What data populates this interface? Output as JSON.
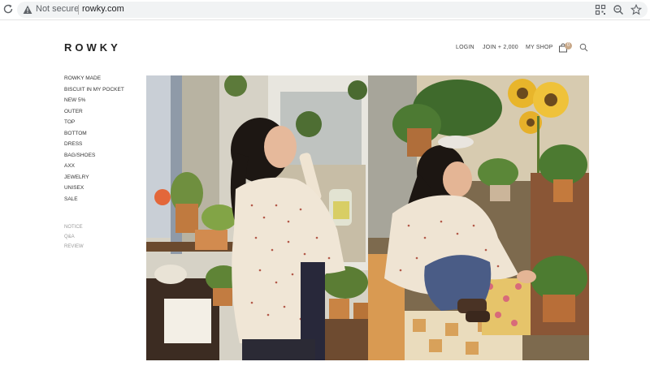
{
  "browser": {
    "security_label": "Not secure",
    "url": "rowky.com",
    "icons": [
      "reload-icon",
      "warning-icon",
      "qr-code-icon",
      "zoom-icon",
      "bookmark-star-icon"
    ]
  },
  "header": {
    "logo": "ROWKY",
    "login": "LOGIN",
    "join": "JOIN",
    "join_bonus": "+ 2,000",
    "my_shop": "MY SHOP",
    "cart_count": "0",
    "accent_color": "#c9a98a"
  },
  "sidebar": {
    "categories": [
      {
        "label": "ROWKY MADE"
      },
      {
        "label": "BISCUIT IN MY POCKET"
      },
      {
        "label": "NEW 5%"
      },
      {
        "label": "OUTER"
      },
      {
        "label": "TOP"
      },
      {
        "label": "BOTTOM"
      },
      {
        "label": "DRESS"
      },
      {
        "label": "BAG/SHOES"
      },
      {
        "label": "AXX"
      },
      {
        "label": "JEWELRY"
      },
      {
        "label": "UNISEX"
      },
      {
        "label": "SALE"
      }
    ],
    "community": [
      {
        "label": "NOTICE"
      },
      {
        "label": "Q&A"
      },
      {
        "label": "REVIEW"
      }
    ]
  },
  "main": {
    "photos": [
      {
        "name": "lookbook-photo-left"
      },
      {
        "name": "lookbook-photo-right"
      }
    ]
  }
}
